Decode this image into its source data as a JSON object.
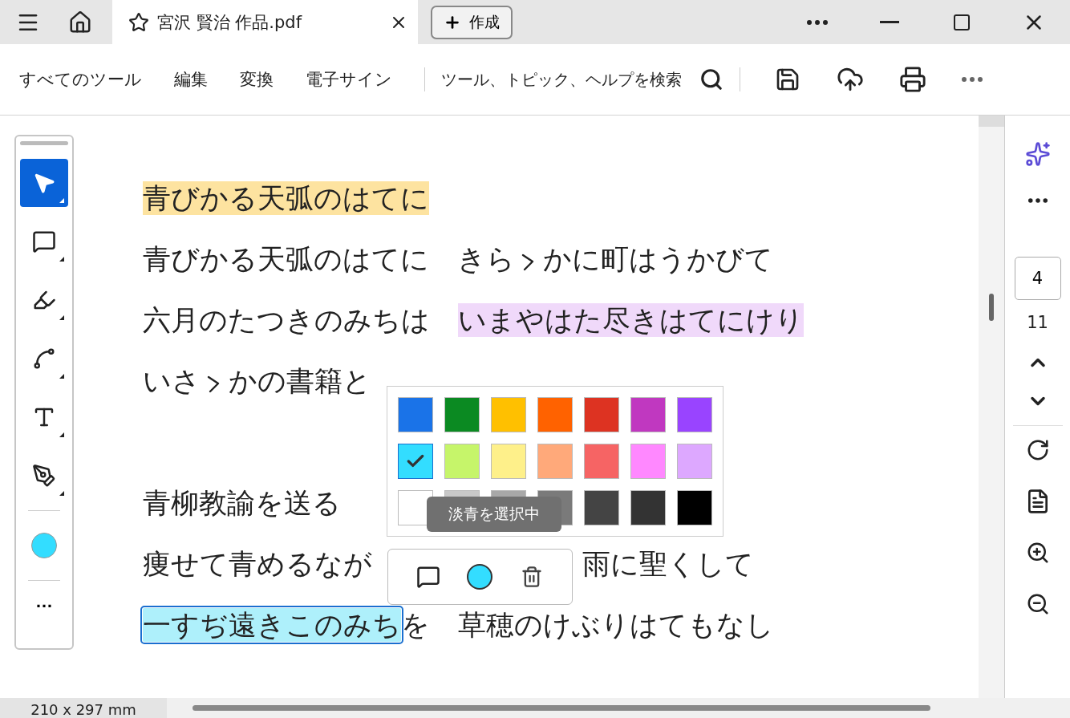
{
  "tab": {
    "title": "宮沢 賢治 作品.pdf",
    "favorite": false
  },
  "create_button": {
    "label": "作成"
  },
  "menu": [
    {
      "label": "すべてのツール"
    },
    {
      "label": "編集"
    },
    {
      "label": "変換"
    },
    {
      "label": "電子サイン"
    }
  ],
  "search": {
    "placeholder": "ツール、トピック、ヘルプを検索"
  },
  "tools": [
    {
      "kind": "select",
      "selected": true
    },
    {
      "kind": "comment",
      "selected": false
    },
    {
      "kind": "highlight",
      "selected": false
    },
    {
      "kind": "draw",
      "selected": false
    },
    {
      "kind": "textbox",
      "selected": false
    },
    {
      "kind": "sign",
      "selected": false
    }
  ],
  "tool_color": {
    "color": "#33ddff"
  },
  "more_tools": "…",
  "document": [
    {
      "kind": "heading",
      "segments": [
        {
          "kind": "text",
          "text": "青びかる天弧のはてに",
          "color": "#fde3a0"
        }
      ]
    },
    {
      "kind": "verse",
      "segments": [
        {
          "kind": "text",
          "text": "青びかる天弧のはてに　きら"
        },
        {
          "kind": "iteration_mark"
        },
        {
          "kind": "text",
          "text": "かに町はうかびて"
        }
      ]
    },
    {
      "kind": "verse",
      "segments": [
        {
          "kind": "text",
          "text": "六月のたつきのみちは　"
        },
        {
          "kind": "text",
          "text": "いまやはた尽きはてにけり",
          "color": "#f0d9fa"
        }
      ]
    },
    {
      "kind": "verse",
      "segments": [
        {
          "kind": "text",
          "text": "いさ"
        },
        {
          "kind": "iteration_mark"
        },
        {
          "kind": "text",
          "text": "かの書籍と"
        }
      ]
    },
    {
      "kind": "blank"
    },
    {
      "kind": "heading",
      "segments": [
        {
          "kind": "text",
          "text": "青柳教諭を送る"
        }
      ]
    },
    {
      "kind": "split",
      "segments": [
        {
          "kind": "text",
          "text": "痩せて青めるなが"
        },
        {
          "kind": "text",
          "text": "雨に聖くして"
        }
      ]
    },
    {
      "kind": "verse",
      "segments": [
        {
          "kind": "text",
          "text": "一すぢ遠きこのみち",
          "color": "#aef0fb",
          "selected": true
        },
        {
          "kind": "text",
          "text": "を　草穂のけぶりはてもなし"
        }
      ]
    }
  ],
  "palette": [
    [
      {
        "color": "#1a73e8",
        "selected": false
      },
      {
        "color": "#0b8a22",
        "selected": false
      },
      {
        "color": "#ffc000",
        "selected": false
      },
      {
        "color": "#ff6200",
        "selected": false
      },
      {
        "color": "#dd3322",
        "selected": false
      },
      {
        "color": "#c038c0",
        "selected": false
      },
      {
        "color": "#9944ff",
        "selected": false
      }
    ],
    [
      {
        "color": "#33ddff",
        "selected": true
      },
      {
        "color": "#c6f56a",
        "selected": false
      },
      {
        "color": "#fef08a",
        "selected": false
      },
      {
        "color": "#ffa97a",
        "selected": false
      },
      {
        "color": "#f66464",
        "selected": false
      },
      {
        "color": "#ff88ff",
        "selected": false
      },
      {
        "color": "#dda8ff",
        "selected": false
      }
    ],
    [
      {
        "color": "#ffffff",
        "selected": false
      },
      {
        "color": "#c8c8c8",
        "selected": false
      },
      {
        "color": "#a8a8a8",
        "selected": false
      },
      {
        "color": "#7a7a7a",
        "selected": false
      },
      {
        "color": "#444444",
        "selected": false
      },
      {
        "color": "#333333",
        "selected": false
      },
      {
        "color": "#000000",
        "selected": false
      }
    ]
  ],
  "tooltip": "淡青を選択中",
  "mini_toolbar": {
    "color": "#33ddff"
  },
  "page": {
    "current": "4",
    "total": "11"
  },
  "status": "210 x 297 mm"
}
